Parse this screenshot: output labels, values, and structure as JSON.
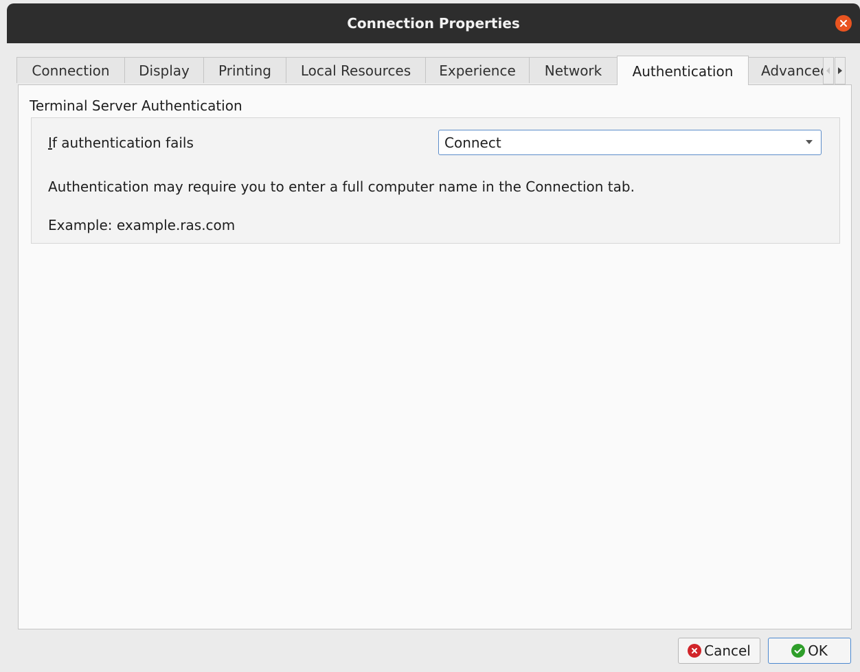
{
  "window": {
    "title": "Connection Properties"
  },
  "tabs": [
    {
      "label": "Connection"
    },
    {
      "label": "Display"
    },
    {
      "label": "Printing"
    },
    {
      "label": "Local Resources"
    },
    {
      "label": "Experience"
    },
    {
      "label": "Network"
    },
    {
      "label": "Authentication",
      "active": true
    },
    {
      "label": "Advanced"
    }
  ],
  "section": {
    "title": "Terminal Server Authentication",
    "field_label_mnemonic": "I",
    "field_label_rest": "f authentication fails",
    "combo_value": "Connect",
    "info": "Authentication may require you to enter a full computer name in the Connection tab.",
    "example": "Example: example.ras.com"
  },
  "buttons": {
    "cancel": "Cancel",
    "ok": "OK"
  },
  "colors": {
    "close": "#e95420",
    "cancel_icon": "#d1252a",
    "ok_icon": "#2e9e2a",
    "focus_border": "#5b8cc9"
  }
}
